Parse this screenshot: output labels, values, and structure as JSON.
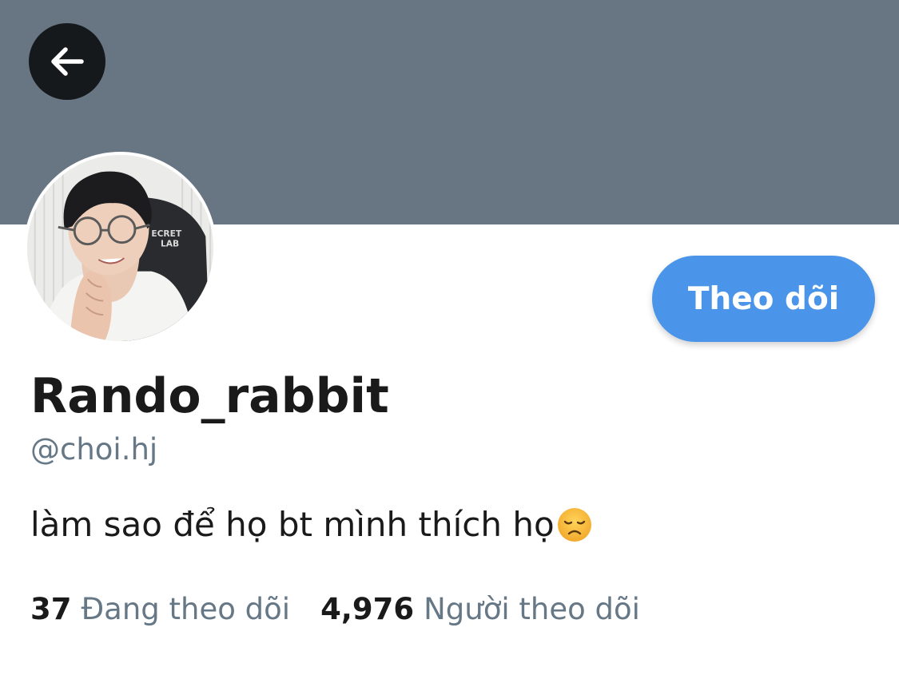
{
  "header": {
    "back_icon": "arrow-left-icon",
    "banner_color": "#687684"
  },
  "profile": {
    "display_name": "Rando_rabbit",
    "handle": "@choi.hj",
    "bio": "làm sao để họ bt mình thích họ",
    "bio_emoji": "disappointed-face-icon",
    "avatar_chair_text": "ECRET\nLAB"
  },
  "actions": {
    "follow_label": "Theo dõi",
    "follow_color": "#4a95ea"
  },
  "stats": {
    "following_count": "37",
    "following_label": "Đang theo dõi",
    "followers_count": "4,976",
    "followers_label": "Người theo dõi"
  }
}
